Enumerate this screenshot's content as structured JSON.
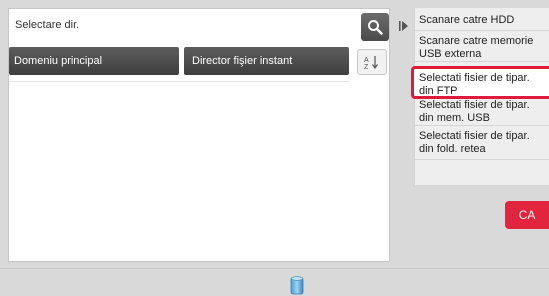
{
  "header": {
    "title": "Selectare dir."
  },
  "tabs": [
    {
      "label": "Domeniu principal"
    },
    {
      "label": "Director fişier instant"
    }
  ],
  "side_menu": {
    "items": [
      {
        "label": "Scanare catre HDD"
      },
      {
        "label": "Scanare catre memorie USB externa"
      },
      {
        "label": "Selectati fisier de tipar. din FTP",
        "selected": true
      },
      {
        "label": "Selectati fisier de tipar. din mem. USB"
      },
      {
        "label": "Selectati fisier de tipar. din fold. retea"
      }
    ]
  },
  "ca_button": {
    "label": "CA"
  },
  "colors": {
    "accent_red": "#e0193f",
    "tab_dark": "#4a4a4a",
    "panel_bg": "#eeeeee"
  },
  "icons": {
    "search": "search-icon",
    "sort": "sort-az-icon",
    "side_arrow": "expand-arrow-icon",
    "toner": "toner-icon"
  }
}
